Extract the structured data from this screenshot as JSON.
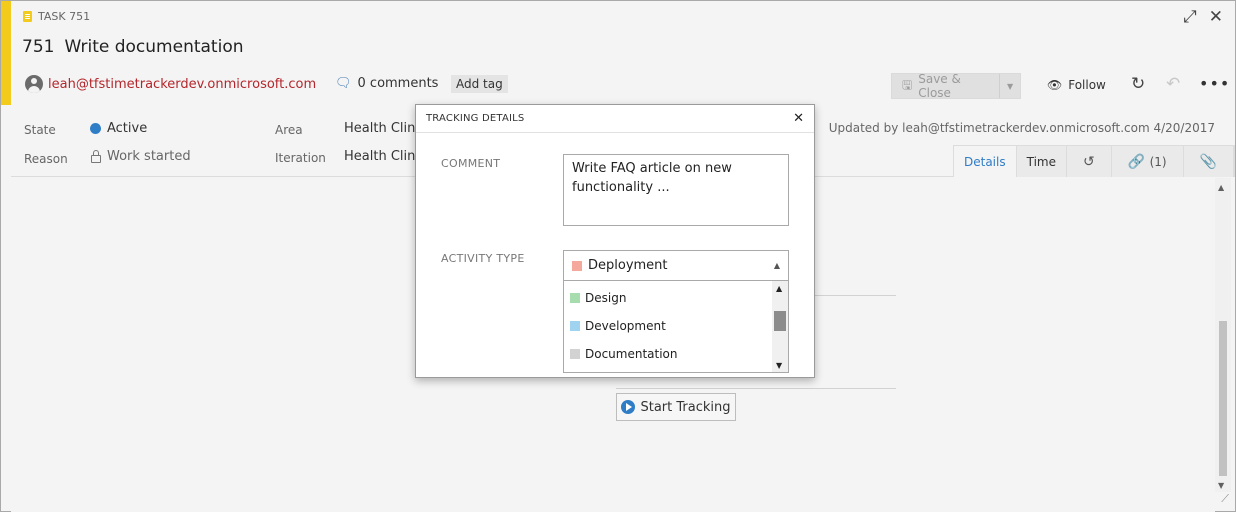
{
  "header": {
    "task_kind": "TASK 751",
    "id": "751",
    "title": "Write documentation",
    "assignee": "leah@tfstimetrackerdev.onmicrosoft.com",
    "comments": "0 comments",
    "add_tag": "Add tag",
    "save_close": "Save & Close",
    "follow": "Follow"
  },
  "fields": {
    "state_label": "State",
    "state_value": "Active",
    "reason_label": "Reason",
    "reason_value": "Work started",
    "area_label": "Area",
    "area_value": "Health Clinic",
    "iteration_label": "Iteration",
    "iteration_value": "Health Clinic",
    "updated": "Updated by leah@tfstimetrackerdev.onmicrosoft.com 4/20/2017"
  },
  "tabs": {
    "details": "Details",
    "time": "Time",
    "links": "(1)"
  },
  "dialog": {
    "title": "TRACKING DETAILS",
    "comment_label": "COMMENT",
    "comment_value": "Write FAQ article on new functionality ...",
    "activity_label": "ACTIVITY TYPE",
    "selected": "Deployment",
    "options": [
      "Design",
      "Development",
      "Documentation"
    ]
  },
  "tracking": {
    "start_label": "Start Tracking"
  },
  "colors": {
    "accent": "#f2cb1d",
    "active_state": "#2f7dc6",
    "assignee_text": "#b3262b",
    "deployment": "#f4a99c",
    "design": "#a6dcae",
    "development": "#9fd3f0",
    "documentation": "#d2d2d2"
  }
}
